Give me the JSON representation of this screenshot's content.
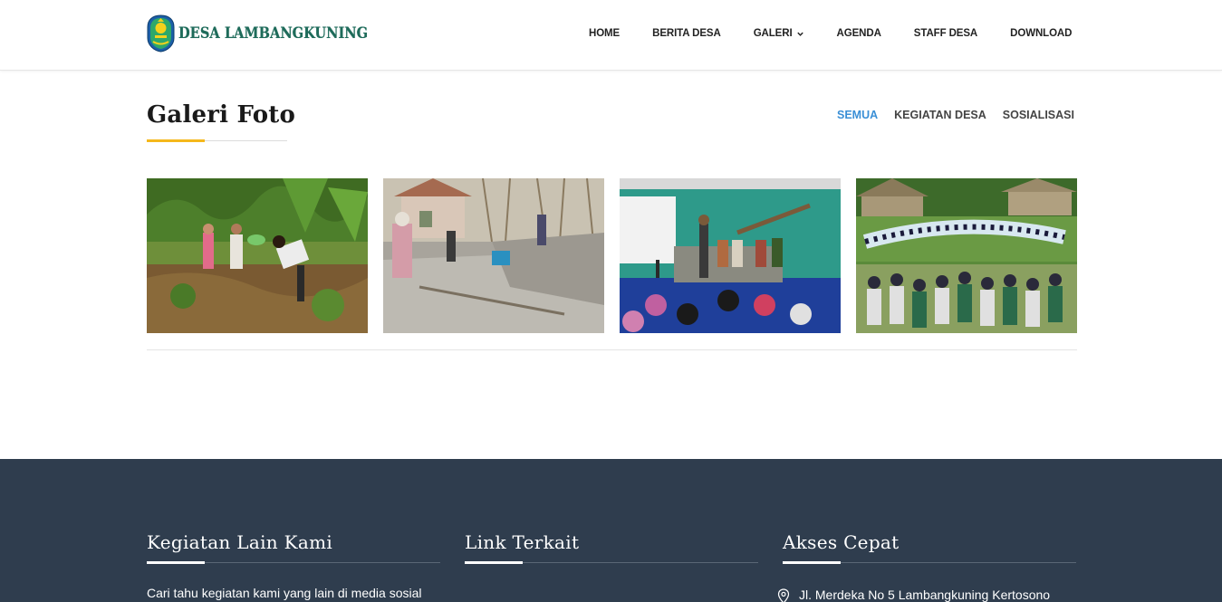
{
  "header": {
    "logo_text": "DESA LAMBANGKUNING",
    "nav": [
      {
        "label": "HOME"
      },
      {
        "label": "BERITA DESA"
      },
      {
        "label": "GALERI",
        "has_dropdown": true
      },
      {
        "label": "AGENDA"
      },
      {
        "label": "STAFF DESA"
      },
      {
        "label": "DOWNLOAD"
      }
    ]
  },
  "gallery": {
    "title": "Galeri Foto",
    "filters": [
      {
        "label": "SEMUA",
        "active": true
      },
      {
        "label": "KEGIATAN DESA",
        "active": false
      },
      {
        "label": "SOSIALISASI",
        "active": false
      }
    ],
    "photos": [
      {
        "subject": "planting-in-garden"
      },
      {
        "subject": "road-construction"
      },
      {
        "subject": "socialization-meeting"
      },
      {
        "subject": "tug-of-war-outdoor"
      }
    ]
  },
  "footer": {
    "col1": {
      "title": "Kegiatan Lain Kami",
      "text": "Cari tahu kegiatan kami yang lain di media sosial"
    },
    "col2": {
      "title": "Link Terkait"
    },
    "col3": {
      "title": "Akses Cepat",
      "address": "Jl. Merdeka No 5 Lambangkuning Kertosono"
    }
  },
  "colors": {
    "accent_yellow": "#f5b81c",
    "filter_active": "#3a8fd6",
    "logo_green": "#1e6b5a",
    "footer_bg": "#2f3d4e"
  }
}
